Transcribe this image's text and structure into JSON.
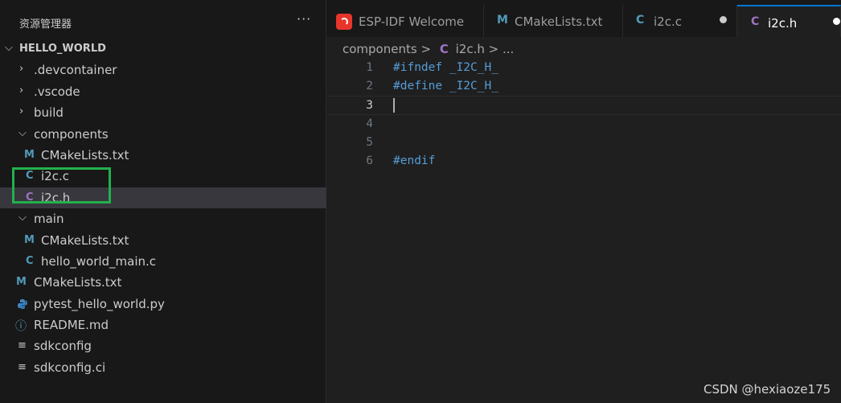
{
  "sidebar": {
    "title": "资源管理器",
    "more_icon": "···",
    "root": "HELLO_WORLD",
    "items": [
      {
        "label": ".devcontainer",
        "type": "folder",
        "state": "collapsed"
      },
      {
        "label": ".vscode",
        "type": "folder",
        "state": "collapsed"
      },
      {
        "label": "build",
        "type": "folder",
        "state": "collapsed"
      },
      {
        "label": "components",
        "type": "folder",
        "state": "expanded"
      },
      {
        "label": "CMakeLists.txt",
        "type": "cmake",
        "icon": "M"
      },
      {
        "label": "i2c.c",
        "type": "c-source",
        "icon": "C"
      },
      {
        "label": "i2c.h",
        "type": "c-header",
        "icon": "C"
      },
      {
        "label": "main",
        "type": "folder",
        "state": "expanded"
      },
      {
        "label": "CMakeLists.txt",
        "type": "cmake",
        "icon": "M"
      },
      {
        "label": "hello_world_main.c",
        "type": "c-source",
        "icon": "C"
      },
      {
        "label": "CMakeLists.txt",
        "type": "cmake",
        "icon": "M"
      },
      {
        "label": "pytest_hello_world.py",
        "type": "python",
        "icon": "python-icon"
      },
      {
        "label": "README.md",
        "type": "markdown",
        "icon": "ⓘ"
      },
      {
        "label": "sdkconfig",
        "type": "config",
        "icon": "≡"
      },
      {
        "label": "sdkconfig.ci",
        "type": "config",
        "icon": "≡"
      }
    ]
  },
  "tabs": [
    {
      "label": "ESP-IDF Welcome",
      "icon": "esp-idf-icon"
    },
    {
      "label": "CMakeLists.txt",
      "icon": "M"
    },
    {
      "label": "i2c.c",
      "icon": "C",
      "modified": true
    },
    {
      "label": "i2c.h",
      "icon": "C",
      "modified": true,
      "active": true
    }
  ],
  "breadcrumb": {
    "folder": "components",
    "separator": ">",
    "file_icon": "C",
    "file": "i2c.h",
    "ellipsis": "..."
  },
  "code": {
    "lines": [
      {
        "n": "1",
        "text": "#ifndef _I2C_H_"
      },
      {
        "n": "2",
        "text": "#define _I2C_H_"
      },
      {
        "n": "3",
        "text": ""
      },
      {
        "n": "4",
        "text": ""
      },
      {
        "n": "5",
        "text": ""
      },
      {
        "n": "6",
        "text": "#endif"
      }
    ],
    "current_line": 3
  },
  "watermark": "CSDN @hexiaoze175",
  "colors": {
    "accent": "#0078d4",
    "highlight_box": "#22b14c",
    "c_icon": "#519aba",
    "h_icon": "#a074c4",
    "keyword": "#569cd6"
  }
}
